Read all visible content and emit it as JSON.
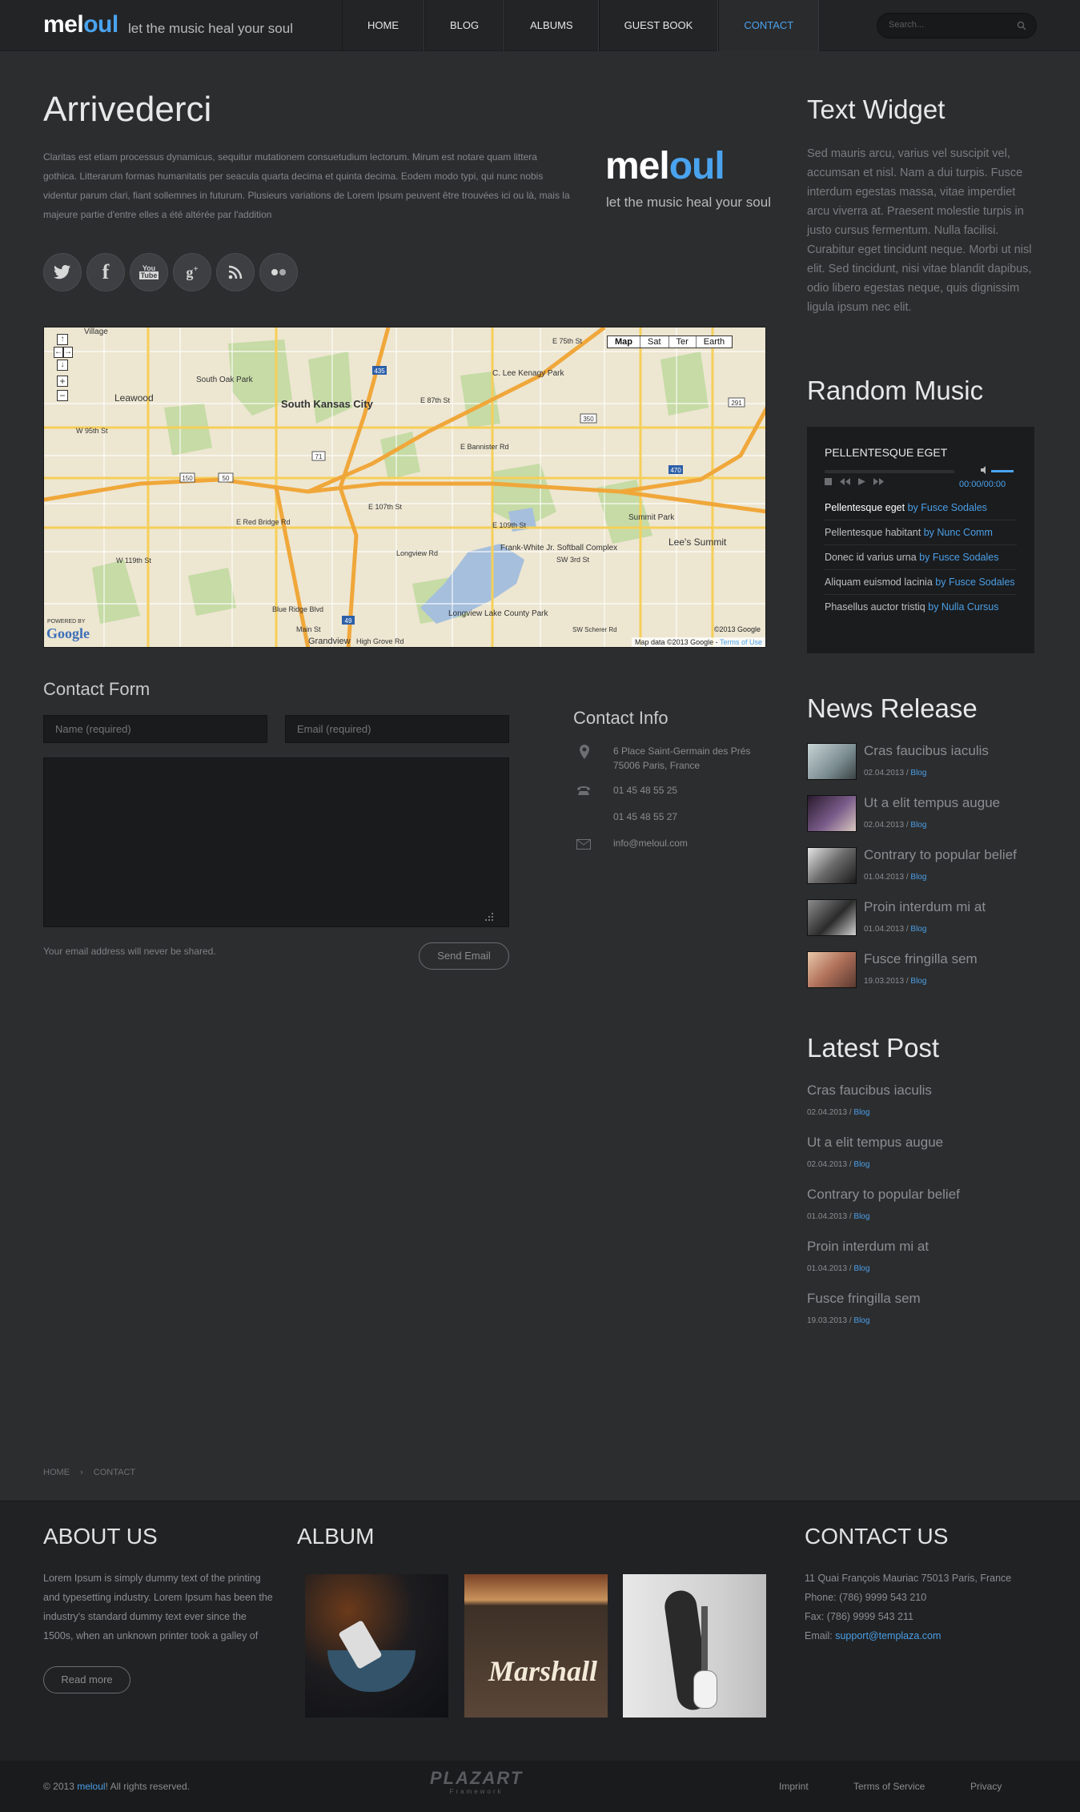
{
  "header": {
    "logo_main": "mel",
    "logo_accent": "oul",
    "tagline": "let the music heal your soul",
    "nav": [
      "HOME",
      "BLOG",
      "ALBUMS",
      "GUEST BOOK",
      "CONTACT"
    ],
    "active_nav": "CONTACT",
    "search_placeholder": "Search..."
  },
  "main": {
    "title": "Arrivederci",
    "intro": "Claritas est etiam processus dynamicus, sequitur mutationem consuetudium lectorum. Mirum est notare quam littera gothica. Litterarum formas humanitatis per seacula quarta decima et quinta decima. Eodem modo typi, qui nunc nobis videntur parum clari, fiant sollemnes in futurum. Plusieurs variations de Lorem Ipsum peuvent être trouvées ici ou là, mais la majeure partie d'entre elles a été altérée par l'addition",
    "logo_main": "mel",
    "logo_accent": "oul",
    "logo_tagline": "let the music heal your soul",
    "social_icons": [
      "twitter-icon",
      "facebook-icon",
      "youtube-icon",
      "googleplus-icon",
      "rss-icon",
      "flickr-icon"
    ]
  },
  "map": {
    "type_buttons": [
      "Map",
      "Sat",
      "Ter",
      "Earth"
    ],
    "places": [
      "Village",
      "South Oak Park",
      "Leawood",
      "South Kansas City",
      "C. Lee Kenagy Park",
      "Frank-White Jr. Softball Complex",
      "Summit Park",
      "Lee's Summit",
      "Longview Lake County Park",
      "Grandview"
    ],
    "roads": [
      "E 75th St",
      "E 87th St",
      "W 95th St",
      "E Bannister Rd",
      "E 107th St",
      "E Red Bridge Rd",
      "W 119th St",
      "Longview Rd",
      "E 109th St",
      "SW 3rd St",
      "Blue Ridge Blvd",
      "Main St",
      "High Grove Rd",
      "SW Scherer Rd"
    ],
    "highway_numbers": [
      "435",
      "71",
      "50",
      "350",
      "470",
      "291",
      "49",
      "150"
    ],
    "copyright": "©2013 Google",
    "mapdata": "Map data ©2013 Google",
    "terms": "Terms of Use",
    "powered_by": "POWERED BY",
    "google": "Google"
  },
  "contact_form": {
    "title": "Contact Form",
    "name_placeholder": "Name (required)",
    "email_placeholder": "Email (required)",
    "note": "Your email address will never be shared.",
    "send_label": "Send Email"
  },
  "contact_info": {
    "title": "Contact Info",
    "address_line1": "6 Place Saint-Germain des Prés",
    "address_line2": "75006 Paris, France",
    "phone1": "01 45 48 55 25",
    "phone2": "01 45 48 55 27",
    "email": "info@meloul.com"
  },
  "text_widget": {
    "title": "Text Widget",
    "body": "Sed mauris arcu, varius vel suscipit vel, accumsan et nisl. Nam a dui turpis. Fusce interdum egestas massa, vitae imperdiet arcu viverra at. Praesent molestie turpis in justo cursus fermentum. Nulla facilisi. Curabitur eget tincidunt neque. Morbi ut nisl elit. Sed tincidunt, nisi vitae blandit dapibus, odio libero egestas neque, quis dignissim ligula ipsum nec elit."
  },
  "random_music": {
    "title": "Random Music",
    "now_playing": "PELLENTESQUE EGET",
    "time": "00:00/00:00",
    "tracks": [
      {
        "title": "Pellentesque eget",
        "by": "by Fusce Sodales"
      },
      {
        "title": "Pellentesque habitant",
        "by": "by Nunc Comm"
      },
      {
        "title": "Donec id varius urna",
        "by": "by Fusce Sodales"
      },
      {
        "title": "Aliquam euismod lacinia",
        "by": "by Fusce Sodales"
      },
      {
        "title": "Phasellus auctor tristiq",
        "by": "by Nulla Cursus"
      }
    ]
  },
  "news_release": {
    "title": "News Release",
    "items": [
      {
        "title": "Cras faucibus iaculis",
        "date": "02.04.2013",
        "cat": "Blog"
      },
      {
        "title": "Ut a elit tempus augue",
        "date": "02.04.2013",
        "cat": "Blog"
      },
      {
        "title": "Contrary to popular belief",
        "date": "01.04.2013",
        "cat": "Blog"
      },
      {
        "title": "Proin interdum mi at",
        "date": "01.04.2013",
        "cat": "Blog"
      },
      {
        "title": "Fusce fringilla sem",
        "date": "19.03.2013",
        "cat": "Blog"
      }
    ]
  },
  "latest_post": {
    "title": "Latest Post",
    "items": [
      {
        "title": "Cras faucibus iaculis",
        "date": "02.04.2013",
        "cat": "Blog"
      },
      {
        "title": "Ut a elit tempus augue",
        "date": "02.04.2013",
        "cat": "Blog"
      },
      {
        "title": "Contrary to popular belief",
        "date": "01.04.2013",
        "cat": "Blog"
      },
      {
        "title": "Proin interdum mi at",
        "date": "01.04.2013",
        "cat": "Blog"
      },
      {
        "title": "Fusce fringilla sem",
        "date": "19.03.2013",
        "cat": "Blog"
      }
    ]
  },
  "breadcrumb": {
    "home": "HOME",
    "current": "CONTACT"
  },
  "footer": {
    "about_title": "ABOUT US",
    "about_text": "Lorem Ipsum is simply dummy text of the printing and typesetting industry. Lorem Ipsum has been the industry's standard dummy text ever since the 1500s, when an unknown printer took a galley of",
    "read_more": "Read more",
    "album_title": "ALBUM",
    "album_sign": "Marshall",
    "contact_title": "CONTACT US",
    "contact_address": "11 Quai François Mauriac 75013 Paris, France",
    "contact_phone": "Phone: (786) 9999 543 210",
    "contact_fax": "Fax: (786) 9999 543 211",
    "contact_email_label": "Email:",
    "contact_email": "support@templaza.com"
  },
  "copyright": {
    "prefix": "© 2013 ",
    "brand": "meloul",
    "suffix": "! All rights reserved.",
    "framework_logo": "PLAZART",
    "framework_sub": "Framework",
    "links": [
      "Imprint",
      "Terms of Service",
      "Privacy"
    ]
  }
}
